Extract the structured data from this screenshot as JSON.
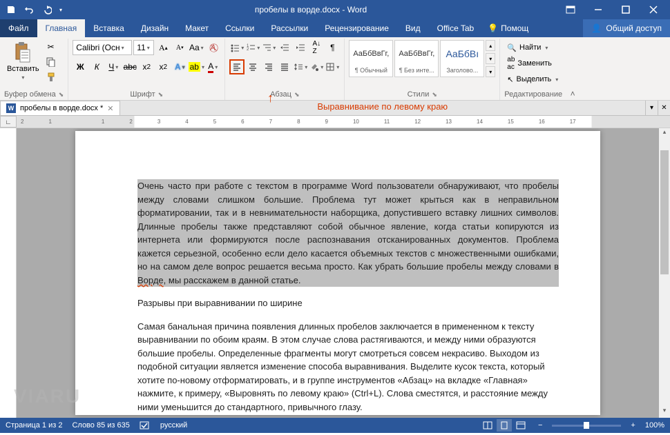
{
  "titlebar": {
    "title": "пробелы в ворде.docx - Word"
  },
  "tabs": {
    "file": "Файл",
    "home": "Главная",
    "insert": "Вставка",
    "design": "Дизайн",
    "layout": "Макет",
    "references": "Ссылки",
    "mailings": "Рассылки",
    "review": "Рецензирование",
    "view": "Вид",
    "officetab": "Office Tab",
    "help_hint": "Помощ",
    "share": "Общий доступ"
  },
  "ribbon": {
    "clipboard": {
      "label": "Буфер обмена",
      "paste": "Вставить"
    },
    "font": {
      "label": "Шрифт",
      "name": "Calibri (Осн",
      "size": "11",
      "case_btn": "Aa"
    },
    "paragraph": {
      "label": "Абзац"
    },
    "styles": {
      "label": "Стили",
      "items": [
        {
          "preview": "АаБбВвГг,",
          "name": "¶ Обычный"
        },
        {
          "preview": "АаБбВвГг,",
          "name": "¶ Без инте..."
        },
        {
          "preview": "АаБбВı",
          "name": "Заголово..."
        }
      ]
    },
    "editing": {
      "label": "Редактирование",
      "find": "Найти",
      "replace": "Заменить",
      "select": "Выделить"
    }
  },
  "doc_tab": {
    "name": "пробелы в ворде.docx *"
  },
  "annotation": "Выравнивание по левому краю",
  "ruler_marks": [
    "2",
    "1",
    "",
    "1",
    "2",
    "3",
    "4",
    "5",
    "6",
    "7",
    "8",
    "9",
    "10",
    "11",
    "12",
    "13",
    "14",
    "15",
    "16",
    "17"
  ],
  "document": {
    "p1_a": "Очень часто при работе с текстом в программе Word пользователи обнаруживают, что пробелы между словами слишком большие. Проблема тут может крыться как в неправильном форматировании, так и в невнимательности наборщика, допустившего вставку лишних символов. Длинные пробелы также представляют собой обычное явление, когда статьи копируются из интернета или формируются после распознавания отсканированных документов. Проблема кажется серьезной, особенно если дело касается объемных текстов с множественными ошибками, но на самом деле вопрос решается весьма просто. Как убрать большие пробелы между словами в ",
    "p1_b": "Ворде",
    "p1_c": ", мы расскажем в данной статье.",
    "p2": "Разрывы при выравнивании по ширине",
    "p3": "Самая банальная причина появления длинных пробелов заключается в примененном к тексту выравнивании по обоим краям. В этом случае слова растягиваются, и между ними образуются большие пробелы. Определенные фрагменты могут смотреться совсем некрасиво. Выходом из подобной ситуации является изменение способа выравнивания. Выделите кусок текста, который хотите по-новому отформатировать, и в группе инструментов «Абзац» на вкладке «Главная» нажмите, к примеру, «Выровнять по левому краю» (Ctrl+L). Слова сместятся, и расстояние между ними уменьшится до стандартного, привычного глазу."
  },
  "statusbar": {
    "page": "Страница 1 из 2",
    "words": "Слово 85 из 635",
    "lang": "русский",
    "zoom": "100%"
  },
  "watermark": "VIARU"
}
